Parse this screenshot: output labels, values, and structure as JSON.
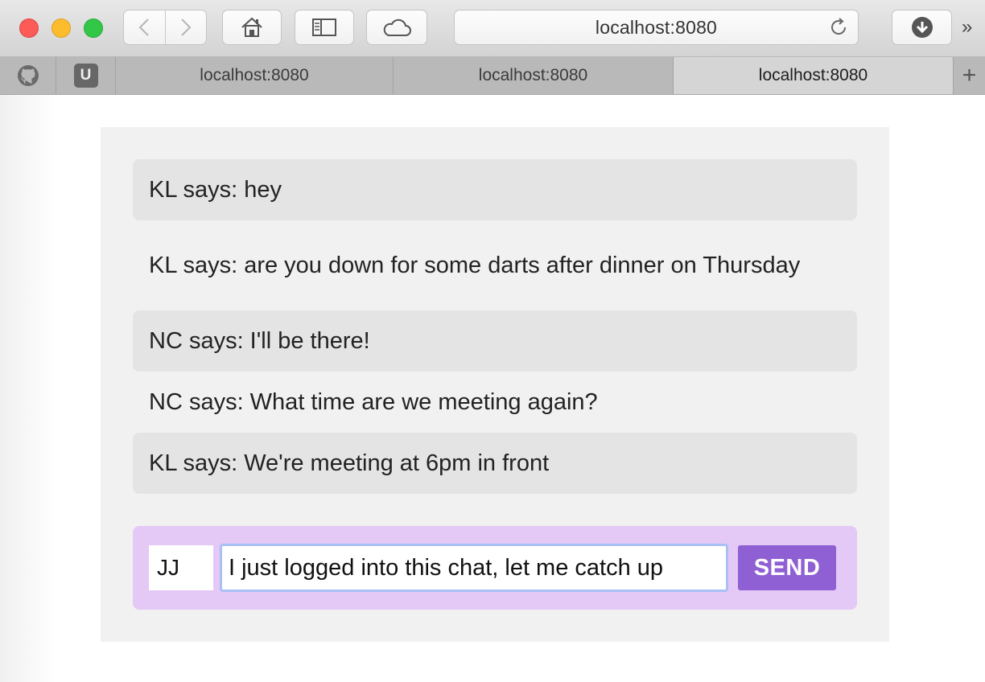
{
  "browser": {
    "address": "localhost:8080",
    "tabs": [
      {
        "label": "localhost:8080"
      },
      {
        "label": "localhost:8080"
      },
      {
        "label": "localhost:8080"
      }
    ],
    "pinned_tab_badge": "U",
    "new_tab_symbol": "+",
    "overflow_symbol": "»",
    "icons": {
      "back": "chevron-left-icon",
      "forward": "chevron-right-icon",
      "home": "home-icon",
      "sidebar": "sidebar-icon",
      "cloud": "cloud-icon",
      "reload": "reload-icon",
      "download": "download-icon",
      "github": "github-icon"
    }
  },
  "chat": {
    "messages": [
      {
        "text": "KL says: hey"
      },
      {
        "text": "KL says: are you down for some darts after dinner on Thursday"
      },
      {
        "text": "NC says: I'll be there!"
      },
      {
        "text": "NC says: What time are we meeting again?"
      },
      {
        "text": "KL says: We're meeting at 6pm in front"
      }
    ],
    "composer": {
      "name_value": "JJ",
      "message_value": "I just logged into this chat, let me catch up",
      "send_label": "SEND"
    }
  },
  "colors": {
    "composer_bg": "#e4c8f6",
    "send_button": "#8f5fd4",
    "message_shade": "#e4e4e4",
    "panel_bg": "#f1f1f1",
    "input_focus_ring": "#a9c0f5"
  }
}
